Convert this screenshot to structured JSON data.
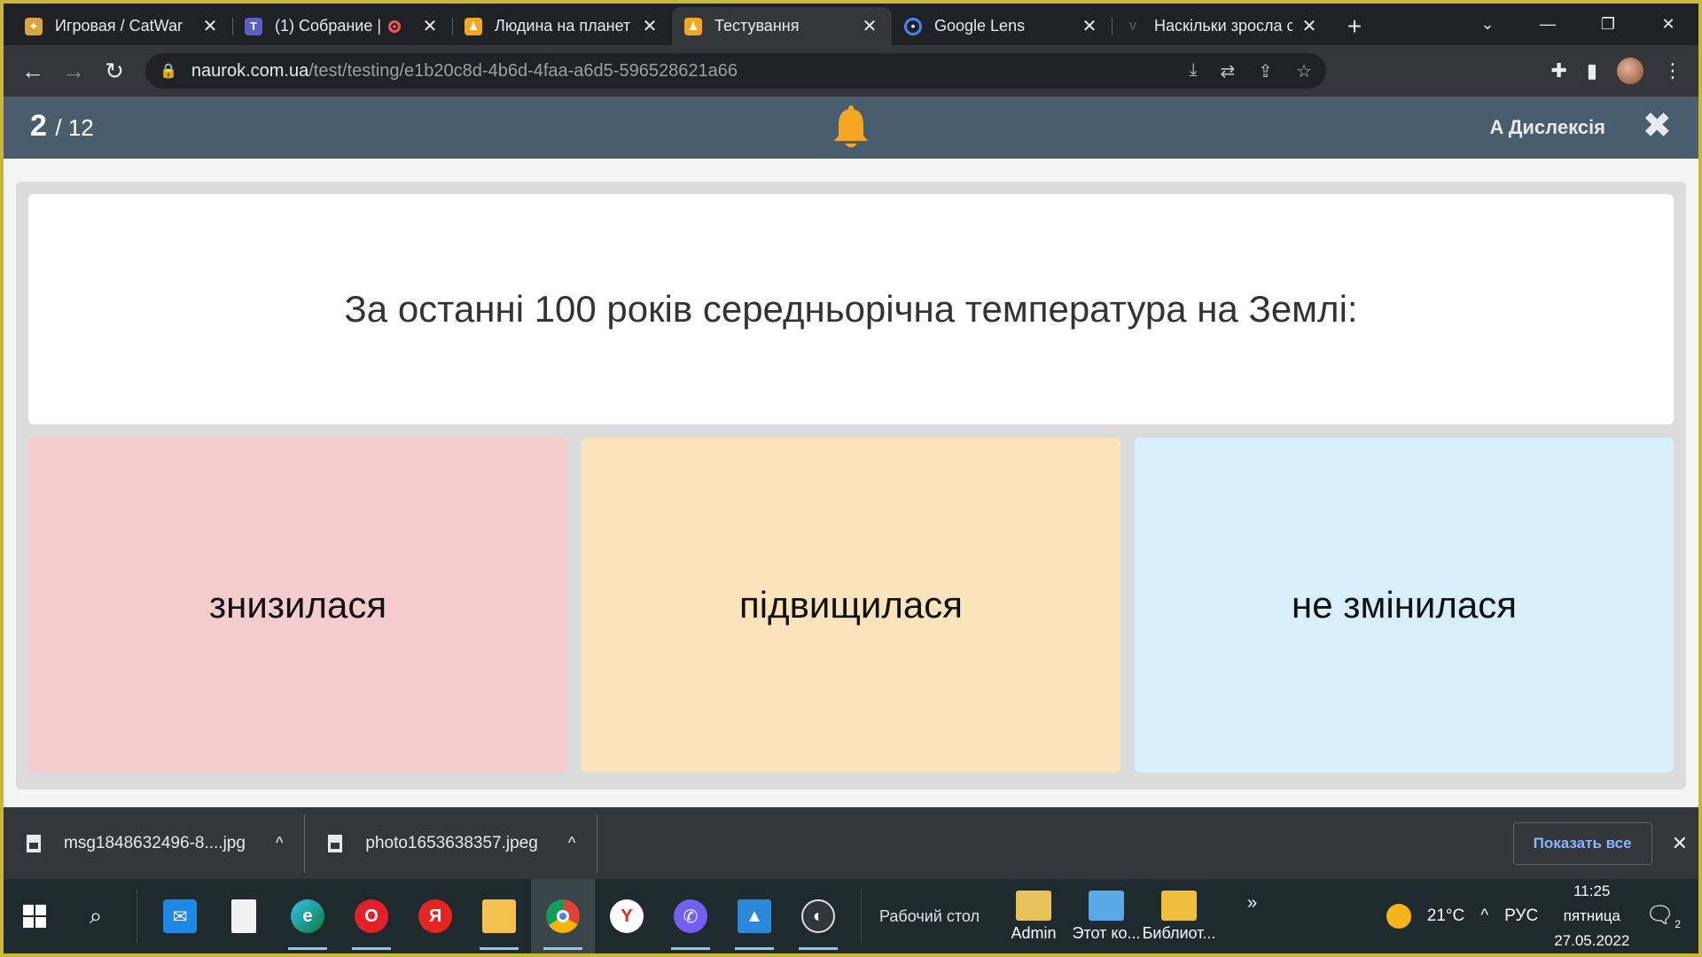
{
  "browser": {
    "tabs": [
      {
        "title": "Игровая / CatWar",
        "favicon_color": "#d9a441",
        "active": false
      },
      {
        "title": "(1) Собрание |",
        "favicon_color": "#5b5fc7",
        "active": false,
        "recording": true
      },
      {
        "title": "Людина на планет",
        "favicon_color": "#f5a623",
        "active": false
      },
      {
        "title": "Тестування",
        "favicon_color": "#f5a623",
        "active": true
      },
      {
        "title": "Google Lens",
        "favicon_color": "#4285f4",
        "active": false
      },
      {
        "title": "Наскільки зросла с",
        "favicon_color": "#202124",
        "active": false
      }
    ],
    "url_host": "naurok.com.ua",
    "url_path": "/test/testing/e1b20c8d-4b6d-4faa-a6d5-596528621a66"
  },
  "quiz": {
    "current": "2",
    "total": "/ 12",
    "dyslexia_label": "A Дислексія",
    "question": "За останні 100 років середньорічна температура на Землі:",
    "answers": [
      {
        "label": "знизилася",
        "color": "#f6cdcf"
      },
      {
        "label": "підвищилася",
        "color": "#fbe3bb"
      },
      {
        "label": "не змінилася",
        "color": "#d7f0fb"
      }
    ]
  },
  "downloads": {
    "items": [
      {
        "name": "msg1848632496-8....jpg"
      },
      {
        "name": "photo1653638357.jpeg"
      }
    ],
    "show_all_label": "Показать все"
  },
  "taskbar": {
    "desktop_label": "Рабочий стол",
    "folders": [
      {
        "label": "Admin"
      },
      {
        "label": "Этот ко..."
      },
      {
        "label": "Библиот..."
      }
    ],
    "weather": "21°C",
    "language": "РУС",
    "time": "11:25",
    "weekday": "пятница",
    "date": "27.05.2022",
    "notification_count": "2"
  }
}
